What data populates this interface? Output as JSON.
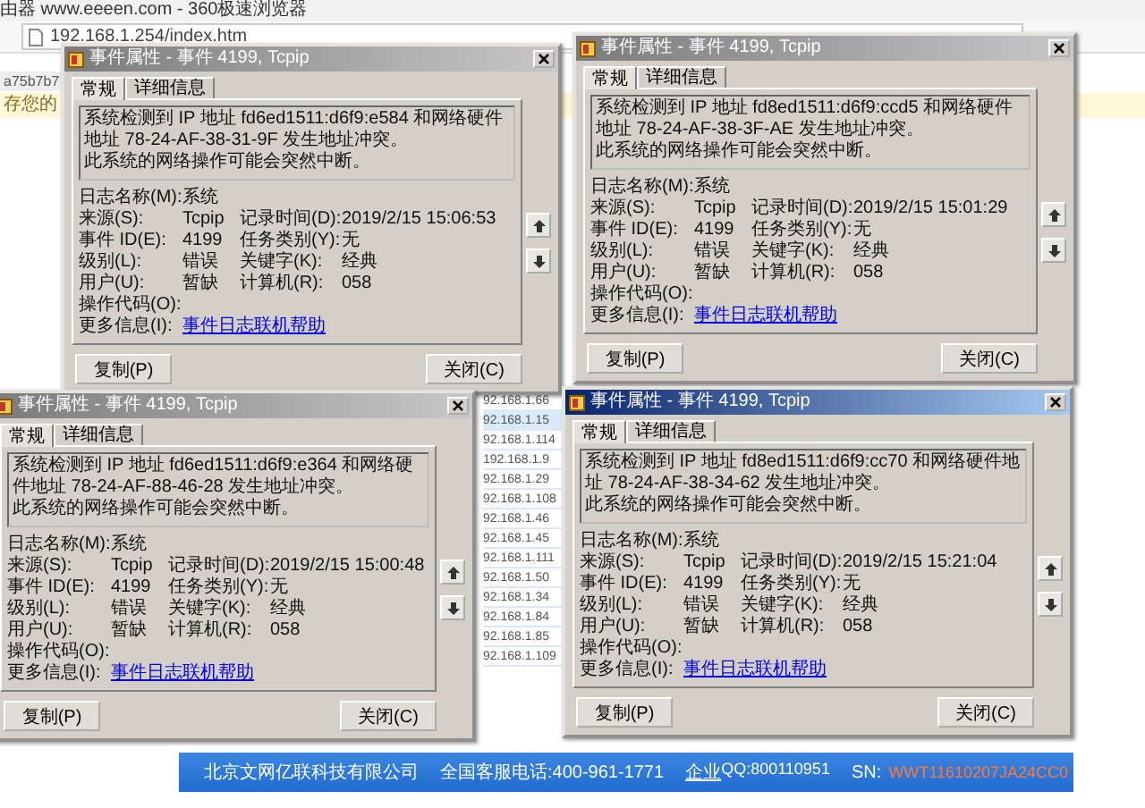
{
  "browser": {
    "tab_title": "由器 www.eeeen.com - 360极速浏览器",
    "address": "192.168.1.254/index.htm",
    "page_tab": "a75b7b7",
    "notice": "存您的",
    "ip_list": [
      {
        "text": "92.168.1.66",
        "selected": false
      },
      {
        "text": "92.168.1.15",
        "selected": true
      },
      {
        "text": "92.168.1.114",
        "selected": false
      },
      {
        "text": "192.168.1.9",
        "selected": false
      },
      {
        "text": "92.168.1.29",
        "selected": false
      },
      {
        "text": "92.168.1.108",
        "selected": false
      },
      {
        "text": "92.168.1.46",
        "selected": false
      },
      {
        "text": "92.168.1.45",
        "selected": false
      },
      {
        "text": "92.168.1.111",
        "selected": false
      },
      {
        "text": "92.168.1.50",
        "selected": false
      },
      {
        "text": "92.168.1.34",
        "selected": false
      },
      {
        "text": "92.168.1.84",
        "selected": false
      },
      {
        "text": "92.168.1.85",
        "selected": false
      },
      {
        "text": "92.168.1.109",
        "selected": false
      }
    ],
    "footer": {
      "company": "北京文网亿联科技有限公司",
      "phone": "全国客服电话:400-961-1771",
      "qq_link": "企业",
      "qq_number": "QQ:800110951",
      "sn_label": "SN:",
      "sn_value": "WWT11610207JA24CC0"
    }
  },
  "dialogs": [
    {
      "title": "事件属性 - 事件 4199, Tcpip",
      "active": false,
      "tabs": [
        {
          "label": "常规",
          "selected": true
        },
        {
          "label": "详细信息",
          "selected": false
        }
      ],
      "message": [
        "系统检测到 IP 地址 fd6ed1511:d6f9:e584 和网络硬件地址 78-24-AF-38-31-9F 发生地址冲突。",
        "此系统的网络操作可能会突然中断。"
      ],
      "rows": [
        {
          "cells": [
            {
              "kind": "text",
              "label": "日志名称(M):",
              "value": "系统"
            }
          ]
        },
        {
          "cells": [
            {
              "kind": "text",
              "label": "来源(S):",
              "value": "Tcpip"
            },
            {
              "kind": "text",
              "label": "记录时间(D):",
              "value": "2019/2/15 15:06:53"
            }
          ]
        },
        {
          "cells": [
            {
              "kind": "text",
              "label": "事件 ID(E):",
              "value": "4199"
            },
            {
              "kind": "text",
              "label": "任务类别(Y):",
              "value": "无"
            }
          ]
        },
        {
          "cells": [
            {
              "kind": "text",
              "label": "级别(L):",
              "value": "错误"
            },
            {
              "kind": "text",
              "label": "关键字(K):",
              "value": "经典"
            }
          ]
        },
        {
          "cells": [
            {
              "kind": "text",
              "label": "用户(U):",
              "value": "暂缺"
            },
            {
              "kind": "text",
              "label": "计算机(R):",
              "value": "058"
            }
          ]
        },
        {
          "cells": [
            {
              "kind": "text",
              "label": "操作代码(O):"
            }
          ]
        },
        {
          "cells": [
            {
              "kind": "link",
              "label": "更多信息(I):",
              "value": "事件日志联机帮助"
            }
          ]
        }
      ],
      "buttons": [
        "复制(P)",
        "关闭(C)"
      ]
    },
    {
      "title": "事件属性 - 事件 4199, Tcpip",
      "active": false,
      "tabs": [
        {
          "label": "常规",
          "selected": true
        },
        {
          "label": "详细信息",
          "selected": false
        }
      ],
      "message": [
        "系统检测到 IP 地址 fd8ed1511:d6f9:ccd5 和网络硬件地址 78-24-AF-38-3F-AE 发生地址冲突。",
        "此系统的网络操作可能会突然中断。"
      ],
      "rows": [
        {
          "cells": [
            {
              "kind": "text",
              "label": "日志名称(M):",
              "value": "系统"
            }
          ]
        },
        {
          "cells": [
            {
              "kind": "text",
              "label": "来源(S):",
              "value": "Tcpip"
            },
            {
              "kind": "text",
              "label": "记录时间(D):",
              "value": "2019/2/15 15:01:29"
            }
          ]
        },
        {
          "cells": [
            {
              "kind": "text",
              "label": "事件 ID(E):",
              "value": "4199"
            },
            {
              "kind": "text",
              "label": "任务类别(Y):",
              "value": "无"
            }
          ]
        },
        {
          "cells": [
            {
              "kind": "text",
              "label": "级别(L):",
              "value": "错误"
            },
            {
              "kind": "text",
              "label": "关键字(K):",
              "value": "经典"
            }
          ]
        },
        {
          "cells": [
            {
              "kind": "text",
              "label": "用户(U):",
              "value": "暂缺"
            },
            {
              "kind": "text",
              "label": "计算机(R):",
              "value": "058"
            }
          ]
        },
        {
          "cells": [
            {
              "kind": "text",
              "label": "操作代码(O):"
            }
          ]
        },
        {
          "cells": [
            {
              "kind": "link",
              "label": "更多信息(I):",
              "value": "事件日志联机帮助"
            }
          ]
        }
      ],
      "buttons": [
        "复制(P)",
        "关闭(C)"
      ]
    },
    {
      "title": "事件属性 - 事件 4199, Tcpip",
      "active": false,
      "tabs": [
        {
          "label": "常规",
          "selected": true
        },
        {
          "label": "详细信息",
          "selected": false
        }
      ],
      "message": [
        "系统检测到 IP 地址 fd6ed1511:d6f9:e364 和网络硬件地址 78-24-AF-88-46-28 发生地址冲突。",
        "此系统的网络操作可能会突然中断。"
      ],
      "rows": [
        {
          "cells": [
            {
              "kind": "text",
              "label": "日志名称(M):",
              "value": "系统"
            }
          ]
        },
        {
          "cells": [
            {
              "kind": "text",
              "label": "来源(S):",
              "value": "Tcpip"
            },
            {
              "kind": "text",
              "label": "记录时间(D):",
              "value": "2019/2/15 15:00:48"
            }
          ]
        },
        {
          "cells": [
            {
              "kind": "text",
              "label": "事件 ID(E):",
              "value": "4199"
            },
            {
              "kind": "text",
              "label": "任务类别(Y):",
              "value": "无"
            }
          ]
        },
        {
          "cells": [
            {
              "kind": "text",
              "label": "级别(L):",
              "value": "错误"
            },
            {
              "kind": "text",
              "label": "关键字(K):",
              "value": "经典"
            }
          ]
        },
        {
          "cells": [
            {
              "kind": "text",
              "label": "用户(U):",
              "value": "暂缺"
            },
            {
              "kind": "text",
              "label": "计算机(R):",
              "value": "058"
            }
          ]
        },
        {
          "cells": [
            {
              "kind": "text",
              "label": "操作代码(O):"
            }
          ]
        },
        {
          "cells": [
            {
              "kind": "link",
              "label": "更多信息(I):",
              "value": "事件日志联机帮助"
            }
          ]
        }
      ],
      "buttons": [
        "复制(P)",
        "关闭(C)"
      ]
    },
    {
      "title": "事件属性 - 事件 4199, Tcpip",
      "active": true,
      "tabs": [
        {
          "label": "常规",
          "selected": true
        },
        {
          "label": "详细信息",
          "selected": false
        }
      ],
      "message": [
        "系统检测到 IP 地址 fd8ed1511:d6f9:cc70 和网络硬件地址 78-24-AF-38-34-62 发生地址冲突。",
        "此系统的网络操作可能会突然中断。"
      ],
      "rows": [
        {
          "cells": [
            {
              "kind": "text",
              "label": "日志名称(M):",
              "value": "系统"
            }
          ]
        },
        {
          "cells": [
            {
              "kind": "text",
              "label": "来源(S):",
              "value": "Tcpip"
            },
            {
              "kind": "text",
              "label": "记录时间(D):",
              "value": "2019/2/15 15:21:04"
            }
          ]
        },
        {
          "cells": [
            {
              "kind": "text",
              "label": "事件 ID(E):",
              "value": "4199"
            },
            {
              "kind": "text",
              "label": "任务类别(Y):",
              "value": "无"
            }
          ]
        },
        {
          "cells": [
            {
              "kind": "text",
              "label": "级别(L):",
              "value": "错误"
            },
            {
              "kind": "text",
              "label": "关键字(K):",
              "value": "经典"
            }
          ]
        },
        {
          "cells": [
            {
              "kind": "text",
              "label": "用户(U):",
              "value": "暂缺"
            },
            {
              "kind": "text",
              "label": "计算机(R):",
              "value": "058"
            }
          ]
        },
        {
          "cells": [
            {
              "kind": "text",
              "label": "操作代码(O):"
            }
          ]
        },
        {
          "cells": [
            {
              "kind": "link",
              "label": "更多信息(I):",
              "value": "事件日志联机帮助"
            }
          ]
        }
      ],
      "buttons": [
        "复制(P)",
        "关闭(C)"
      ]
    }
  ]
}
